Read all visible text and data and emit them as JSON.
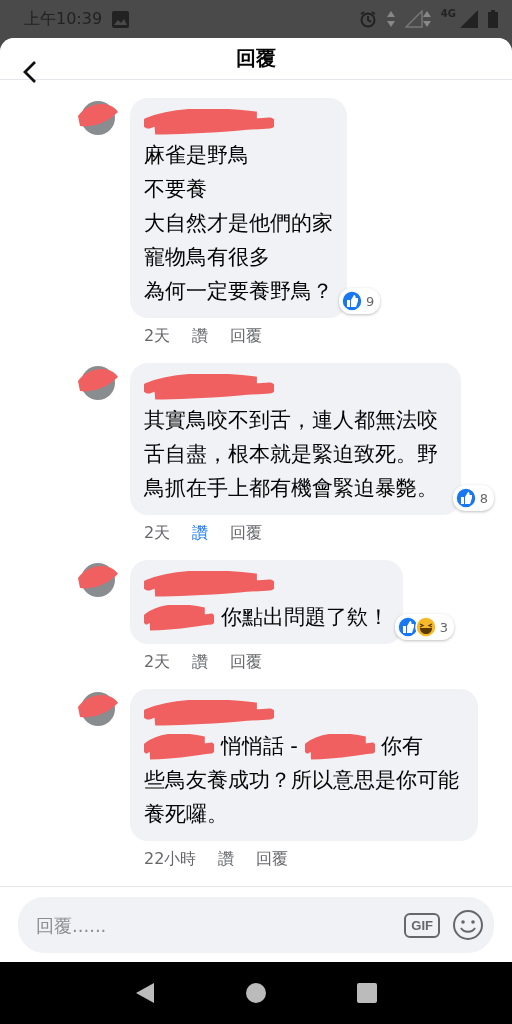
{
  "status_bar": {
    "time": "上午10:39",
    "network": "4G"
  },
  "header": {
    "title": "回覆"
  },
  "comments": [
    {
      "name_redacted": true,
      "body": [
        {
          "kind": "line",
          "text": "麻雀是野鳥"
        },
        {
          "kind": "line",
          "text": "不要養"
        },
        {
          "kind": "line",
          "text": "大自然才是他們的家"
        },
        {
          "kind": "line",
          "text": "寵物鳥有很多"
        },
        {
          "kind": "line",
          "text": "為何一定要養野鳥？"
        }
      ],
      "reactions": [
        {
          "kind": "like"
        }
      ],
      "reaction_count": "9",
      "time": "2天",
      "like_label": "讚",
      "liked": false,
      "reply_label": "回覆"
    },
    {
      "name_redacted": true,
      "body": [
        {
          "kind": "line",
          "text": "其實鳥咬不到舌，連人都無法咬舌自盡，根本就是緊迫致死。野鳥抓在手上都有機會緊迫暴斃。"
        }
      ],
      "reactions": [
        {
          "kind": "like"
        }
      ],
      "reaction_count": "8",
      "time": "2天",
      "like_label": "讚",
      "liked": true,
      "reply_label": "回覆"
    },
    {
      "name_redacted": true,
      "body": [
        {
          "kind": "redacted"
        },
        {
          "kind": "text",
          "text": "你點出問題了欸！"
        }
      ],
      "reactions": [
        {
          "kind": "like"
        },
        {
          "kind": "haha"
        }
      ],
      "reaction_count": "3",
      "time": "2天",
      "like_label": "讚",
      "liked": false,
      "reply_label": "回覆"
    },
    {
      "name_redacted": true,
      "body": [
        {
          "kind": "redacted"
        },
        {
          "kind": "text",
          "text": "悄悄話 -"
        },
        {
          "kind": "redacted"
        },
        {
          "kind": "text",
          "text": "你有"
        },
        {
          "kind": "line",
          "text": "些鳥友養成功？所以意思是你可能養死囉。"
        }
      ],
      "time": "22小時",
      "like_label": "讚",
      "liked": false,
      "reply_label": "回覆"
    }
  ],
  "composer": {
    "placeholder": "回覆......",
    "gif_label": "GIF"
  }
}
